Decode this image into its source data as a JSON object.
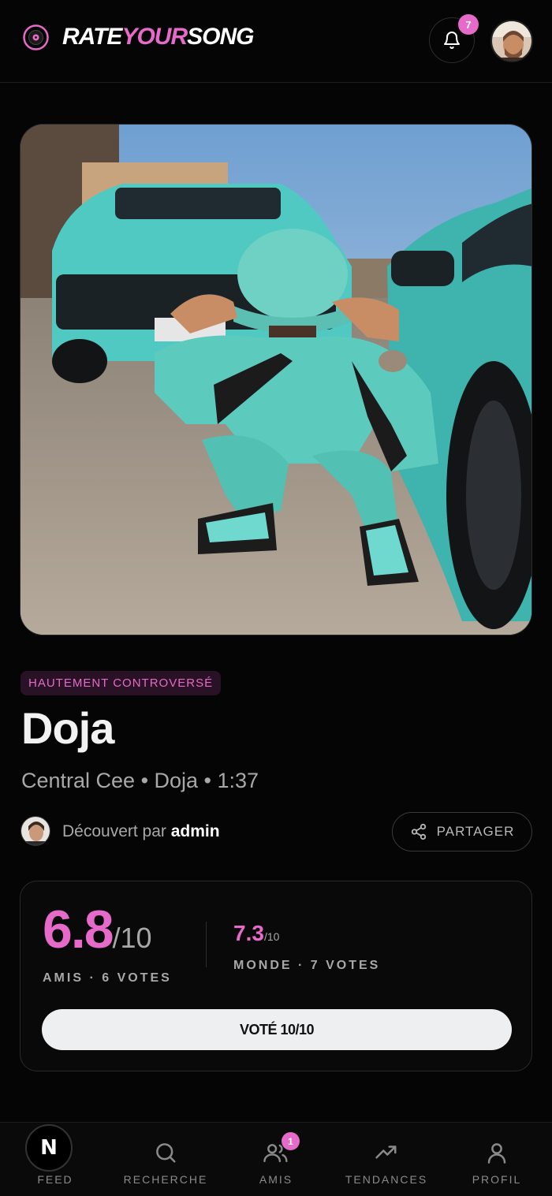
{
  "header": {
    "logo_part1": "RATE",
    "logo_part2": "YOUR",
    "logo_part3": "SONG",
    "notification_count": "7"
  },
  "song": {
    "badge": "HAUTEMENT CONTROVERSÉ",
    "title": "Doja",
    "meta": "Central Cee • Doja • 1:37",
    "discovered_prefix": "Découvert par",
    "discovered_by": "admin",
    "share_label": "PARTAGER"
  },
  "scores": {
    "friends_score": "6.8",
    "friends_out_of": "/10",
    "friends_votes_label": "AMIS · 6 VOTES",
    "world_score": "7.3",
    "world_out_of": "/10",
    "world_votes_label": "MONDE · 7 VOTES",
    "vote_button": "VOTÉ 10/10"
  },
  "nav": {
    "feed": "FEED",
    "feed_glyph": "N",
    "search": "RECHERCHE",
    "friends": "AMIS",
    "friends_badge": "1",
    "trends": "TENDANCES",
    "profile": "PROFIL"
  },
  "colors": {
    "accent": "#e66ac9",
    "background": "#050505",
    "vote_button_bg": "#eeeff1"
  },
  "icons": [
    "vinyl-logo-icon",
    "bell-icon",
    "share-icon",
    "search-icon",
    "friends-icon",
    "trending-icon",
    "profile-icon"
  ]
}
